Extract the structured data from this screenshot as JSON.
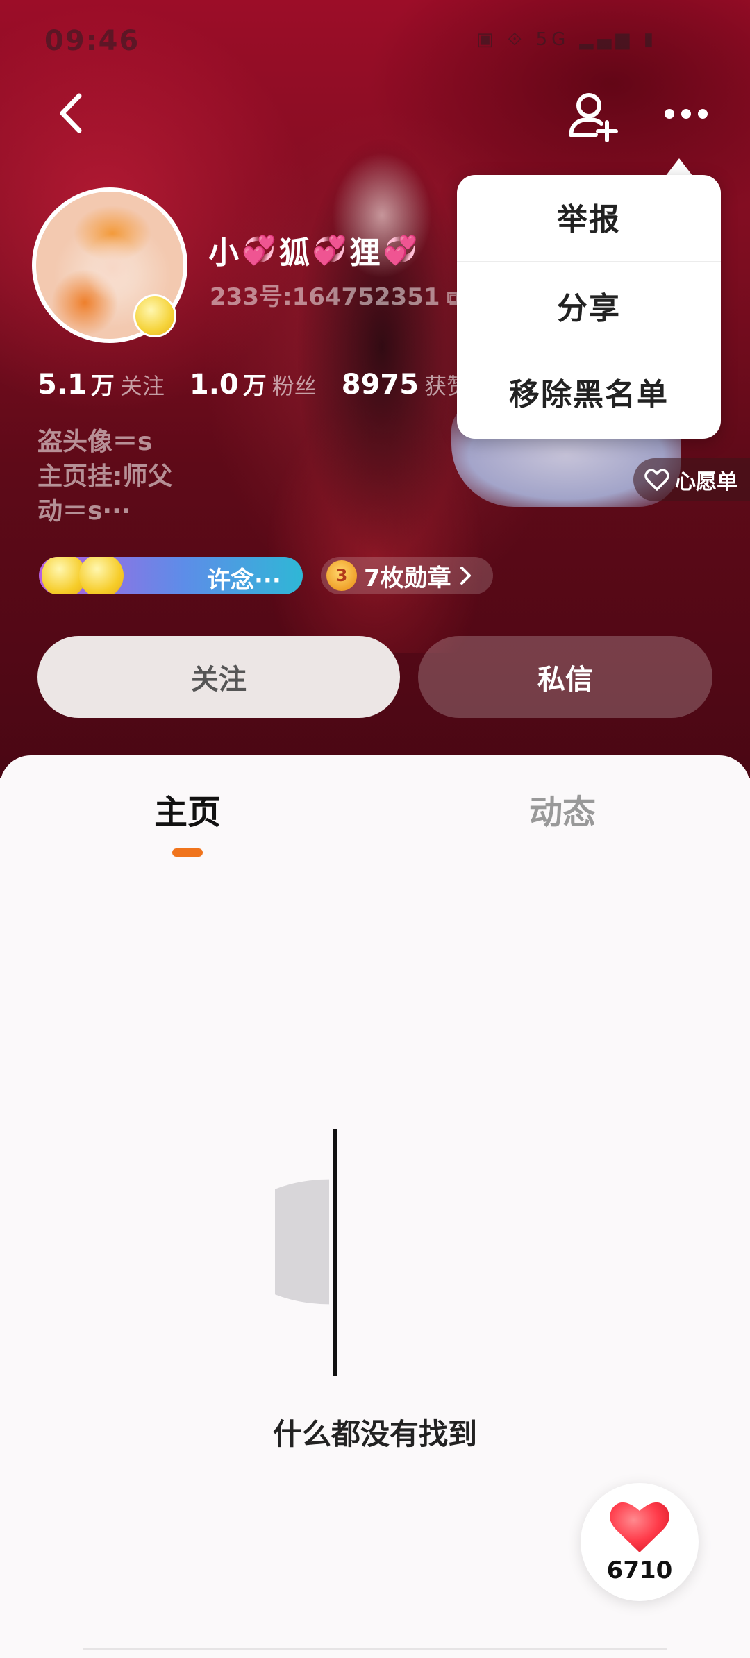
{
  "status_bar": {
    "time": "09:46",
    "icons": "▣ ⟐ 5G ▂▄▆ ▮"
  },
  "popup_menu": {
    "items": [
      "举报",
      "分享",
      "移除黑名单"
    ]
  },
  "profile": {
    "name_parts": [
      "小",
      "狐",
      "狸"
    ],
    "heart": "💞",
    "user_id": "233号:164752351",
    "stats": [
      {
        "num": "5.1",
        "unit": "万",
        "label": "关注"
      },
      {
        "num": "1.0",
        "unit": "万",
        "label": "粉丝"
      },
      {
        "num": "8975",
        "unit": "",
        "label": "获赞"
      }
    ],
    "bio_lines": [
      "盗头像＝s",
      "主页挂:师父",
      "动＝s···"
    ],
    "wishlist_label": "心愿单",
    "tag_text": "许念···",
    "medal_icon": "3",
    "medal_label": "7枚勋章"
  },
  "actions": {
    "follow": "关注",
    "message": "私信"
  },
  "tabs": [
    {
      "label": "主页",
      "active": true
    },
    {
      "label": "动态",
      "active": false
    }
  ],
  "empty_state": {
    "text": "什么都没有找到"
  },
  "like_button": {
    "count": "6710"
  },
  "colors": {
    "accent": "#f0741c",
    "header": "#8c0c24",
    "like": "#ff3b4a"
  }
}
